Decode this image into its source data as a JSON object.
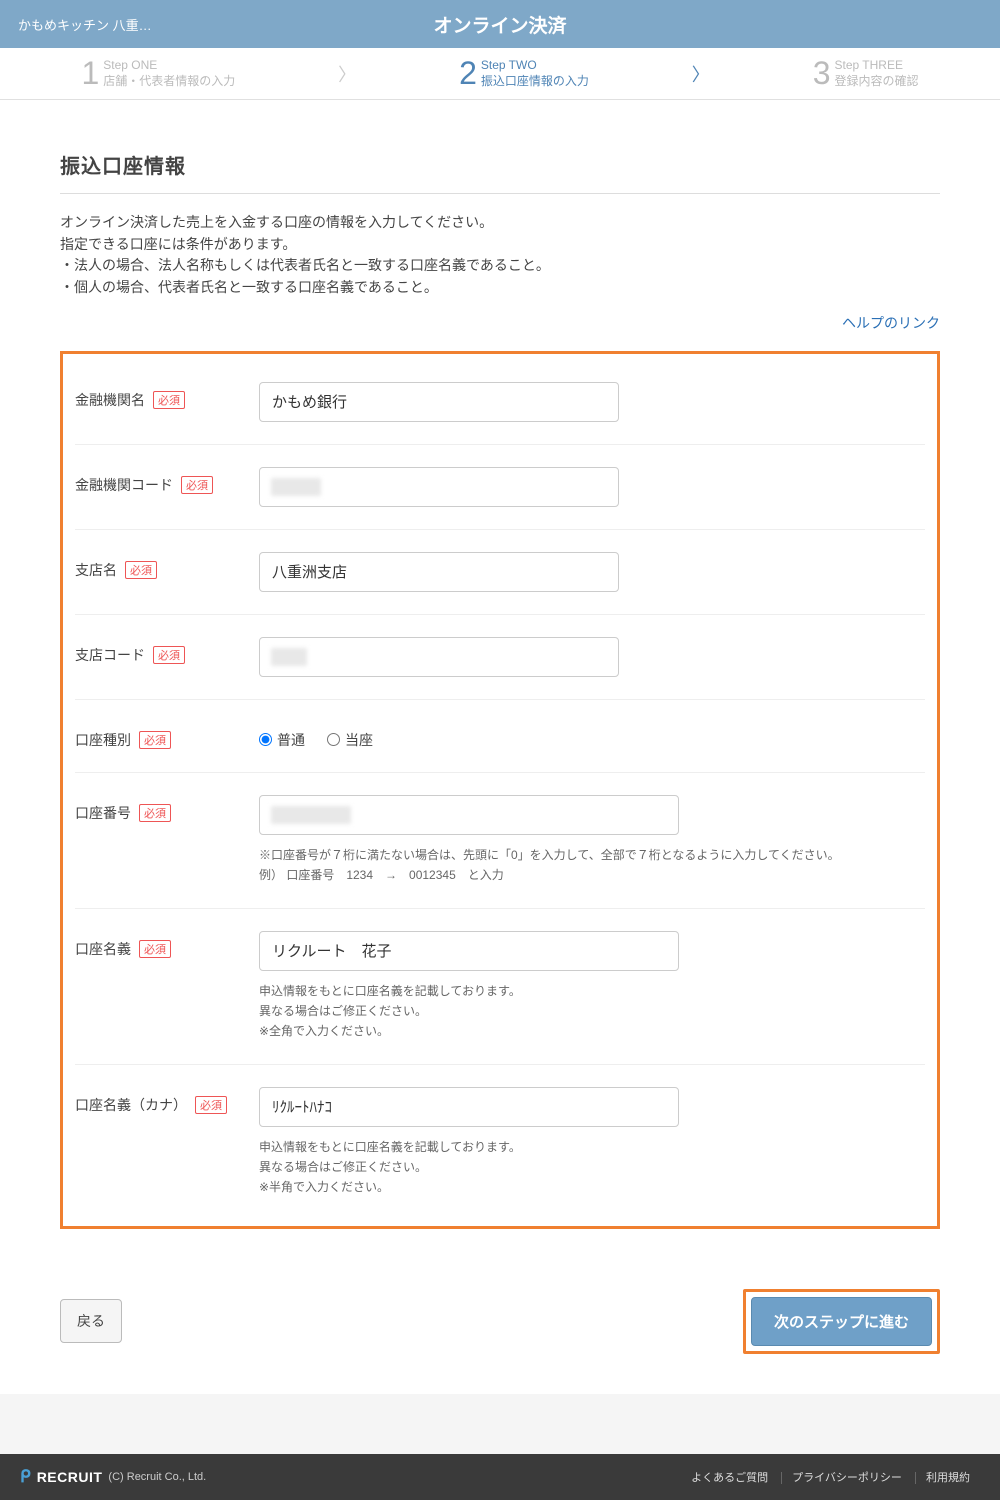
{
  "header": {
    "app_name": "かもめキッチン 八重…",
    "page_title": "オンライン決済"
  },
  "steps": [
    {
      "top": "Step ONE",
      "bottom": "店舗・代表者情報の入力",
      "active": false
    },
    {
      "top": "Step TWO",
      "bottom": "振込口座情報の入力",
      "active": true
    },
    {
      "top": "Step THREE",
      "bottom": "登録内容の確認",
      "active": false
    }
  ],
  "section": {
    "title": "振込口座情報",
    "intro_line1": "オンライン決済した売上を入金する口座の情報を入力してください。",
    "intro_line2": "指定できる口座には条件があります。",
    "intro_line3": "・法人の場合、法人名称もしくは代表者氏名と一致する口座名義であること。",
    "intro_line4": "・個人の場合、代表者氏名と一致する口座名義であること。",
    "help_link": "ヘルプのリンク",
    "required_tag": "必須"
  },
  "form": {
    "bank_name": {
      "label": "金融機関名",
      "value": "かもめ銀行"
    },
    "bank_code": {
      "label": "金融機関コード",
      "value": ""
    },
    "branch_name": {
      "label": "支店名",
      "value": "八重洲支店"
    },
    "branch_code": {
      "label": "支店コード",
      "value": ""
    },
    "account_type": {
      "label": "口座種別",
      "opt1": "普通",
      "opt2": "当座",
      "selected": "普通"
    },
    "account_number": {
      "label": "口座番号",
      "value": "",
      "note1": "※口座番号が７桁に満たない場合は、先頭に「0」を入力して、全部で７桁となるように入力してください。",
      "note2": "例） 口座番号　1234　→　0012345　と入力"
    },
    "account_holder": {
      "label": "口座名義",
      "value": "リクルート　花子",
      "note1": "申込情報をもとに口座名義を記載しております。",
      "note2": "異なる場合はご修正ください。",
      "note3": "※全角で入力ください。"
    },
    "account_holder_kana": {
      "label": "口座名義（カナ）",
      "value": "ﾘｸﾙｰﾄﾊﾅｺ",
      "note1": "申込情報をもとに口座名義を記載しております。",
      "note2": "異なる場合はご修正ください。",
      "note3": "※半角で入力ください。"
    }
  },
  "actions": {
    "back": "戻る",
    "next": "次のステップに進む"
  },
  "footer": {
    "logo": "RECRUIT",
    "copyright": "(C) Recruit Co., Ltd.",
    "link1": "よくあるご質問",
    "link2": "プライバシーポリシー",
    "link3": "利用規約"
  }
}
